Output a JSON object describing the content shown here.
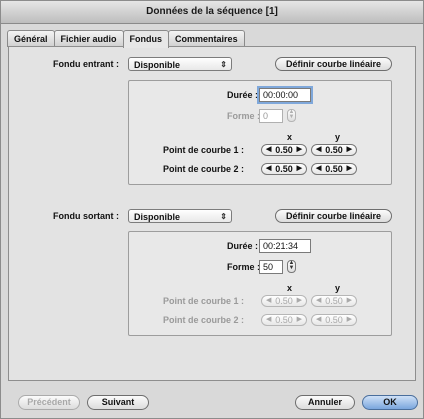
{
  "window": {
    "title": "Données de la séquence [1]"
  },
  "tabs": [
    "Général",
    "Fichier audio",
    "Fondus",
    "Commentaires"
  ],
  "fade_in": {
    "label": "Fondu entrant :",
    "select_value": "Disponible",
    "curve_button": "Définir courbe linéaire",
    "duration_label": "Durée :",
    "duration_value": "00:00:00",
    "shape_label": "Forme :",
    "shape_value": "0",
    "x_header": "x",
    "y_header": "y",
    "point1_label": "Point de courbe 1 :",
    "point2_label": "Point de courbe 2 :",
    "p1x": "0.50",
    "p1y": "0.50",
    "p2x": "0.50",
    "p2y": "0.50"
  },
  "fade_out": {
    "label": "Fondu sortant :",
    "select_value": "Disponible",
    "curve_button": "Définir courbe linéaire",
    "duration_label": "Durée :",
    "duration_value": "00:21:34",
    "shape_label": "Forme :",
    "shape_value": "50",
    "x_header": "x",
    "y_header": "y",
    "point1_label": "Point de courbe 1 :",
    "point2_label": "Point de courbe 2 :",
    "p1x": "0.50",
    "p1y": "0.50",
    "p2x": "0.50",
    "p2y": "0.50"
  },
  "footer": {
    "previous": "Précédent",
    "next": "Suivant",
    "cancel": "Annuler",
    "ok": "OK"
  }
}
